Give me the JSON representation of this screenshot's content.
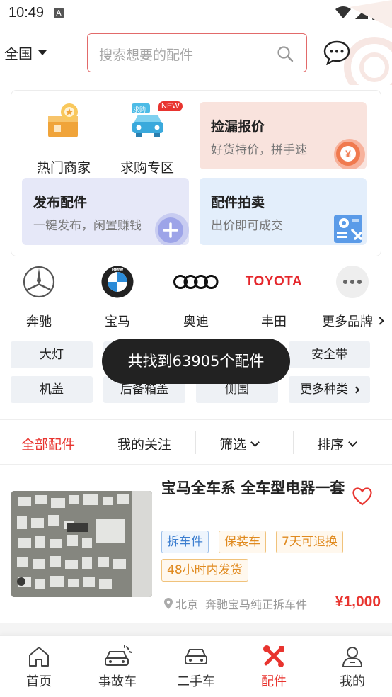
{
  "status_bar": {
    "time": "10:49",
    "notif_letter": "A"
  },
  "header": {
    "region": "全国",
    "search_placeholder": "搜索想要的配件"
  },
  "quick_entries": [
    {
      "label": "热门商家",
      "icon": "shop-medal-icon"
    },
    {
      "label": "求购专区",
      "icon": "car-wanted-icon",
      "badge": "NEW",
      "sticker": "求购"
    }
  ],
  "feature_tiles": [
    {
      "title": "捡漏报价",
      "subtitle": "好货特价，拼手速",
      "icon": "yen-coin-icon",
      "color": "#f9e3dd"
    },
    {
      "title": "发布配件",
      "subtitle": "一键发布，闲置赚钱",
      "icon": "plus-circle-icon",
      "color": "#e6e8f8"
    },
    {
      "title": "配件拍卖",
      "subtitle": "出价即可成交",
      "icon": "auction-icon",
      "color": "#e3eefb"
    }
  ],
  "brands": [
    {
      "name": "奔驰",
      "logo": "mercedes-logo"
    },
    {
      "name": "宝马",
      "logo": "bmw-logo",
      "logo_text": "BMW"
    },
    {
      "name": "奥迪",
      "logo": "audi-logo"
    },
    {
      "name": "丰田",
      "logo": "toyota-logo",
      "logo_text": "TOYOTA"
    },
    {
      "name": "更多品牌",
      "logo": "more-dots-icon"
    }
  ],
  "categories": [
    "大灯",
    "安全带",
    "机盖",
    "后备箱盖",
    "侧围",
    "更多种类"
  ],
  "toast": "共找到63905个配件",
  "filter_tabs": [
    {
      "label": "全部配件",
      "active": true
    },
    {
      "label": "我的关注"
    },
    {
      "label": "筛选"
    },
    {
      "label": "排序"
    }
  ],
  "product": {
    "title": "宝马全车系 全车型电器一套",
    "tags": [
      "拆车件",
      "保装车",
      "7天可退换",
      "48小时内发货"
    ],
    "location": "北京",
    "seller": "奔驰宝马纯正拆车件",
    "price": "¥1,000"
  },
  "bottom_nav": [
    {
      "label": "首页",
      "icon": "home-icon"
    },
    {
      "label": "事故车",
      "icon": "accident-car-icon"
    },
    {
      "label": "二手车",
      "icon": "used-car-icon"
    },
    {
      "label": "配件",
      "icon": "parts-tools-icon",
      "active": true
    },
    {
      "label": "我的",
      "icon": "profile-icon"
    }
  ],
  "colors": {
    "accent": "#e8342f",
    "chip_bg": "#eef1f5"
  }
}
